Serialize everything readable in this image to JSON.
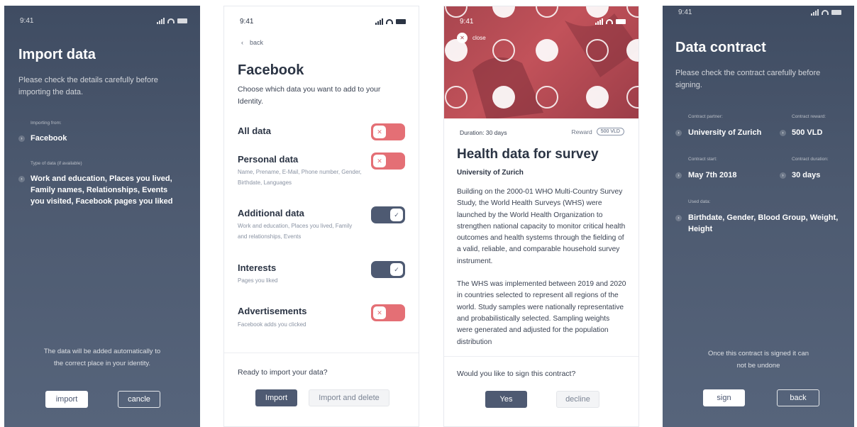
{
  "status_time": "9:41",
  "import_screen": {
    "title": "Import data",
    "subtitle": "Please check the details carefully before importing the data.",
    "from_label": "Importing from:",
    "from_value": "Facebook",
    "type_label": "Type of data (if available)",
    "type_value": "Work and education, Places you lived, Family names, Relationships, Events you visited, Facebook pages you liked",
    "footer_text": "The data will be added automatically to the correct place in your identity.",
    "import_button": "import",
    "cancel_button": "cancle"
  },
  "facebook_screen": {
    "back_label": "back",
    "title": "Facebook",
    "subtitle": "Choose which data you want to add to your Identity.",
    "items": [
      {
        "title": "All data",
        "desc": "",
        "on": false
      },
      {
        "title": "Personal data",
        "desc": "Name, Prename, E-Mail, Phone number, Gender, Birthdate, Languages",
        "on": false
      },
      {
        "title": "Additional data",
        "desc": "Work and education, Places you lived, Family and relationships, Events",
        "on": true
      },
      {
        "title": "Interests",
        "desc": "Pages you liked",
        "on": true
      },
      {
        "title": "Advertisements",
        "desc": "Facebook adds you clicked",
        "on": false
      }
    ],
    "ready_text": "Ready to import your data?",
    "import_button": "Import",
    "import_delete_button": "Import and delete"
  },
  "survey_screen": {
    "close_label": "close",
    "duration": "Duration: 30 days",
    "reward_label": "Reward",
    "reward_badge": "500 VLD",
    "title": "Health data for survey",
    "org": "University of Zurich",
    "paragraph1": "Building on the 2000-01 WHO Multi-Country Survey Study, the World Health Surveys (WHS) were launched by the World Health Organization to strengthen national capacity to monitor critical health outcomes and health systems through the fielding of a valid, reliable, and comparable household survey instrument.",
    "paragraph2": "The WHS was implemented between 2019 and 2020 in countries selected to represent all regions of the world. Study samples were nationally representative and probabilistically selected. Sampling weights were generated and adjusted for the population distribution",
    "question": "Would you like to sign this contract?",
    "yes_button": "Yes",
    "decline_button": "decline"
  },
  "contract_screen": {
    "title": "Data contract",
    "subtitle": "Please check the contract carefully before signing.",
    "partner_label": "Contract partner:",
    "partner_value": "University of Zurich",
    "reward_label": "Contract reward:",
    "reward_value": "500 VLD",
    "start_label": "Contract start:",
    "start_value": "May 7th 2018",
    "duration_label": "Contract duration:",
    "duration_value": "30 days",
    "used_label": "Used data:",
    "used_value": "Birthdate, Gender, Blood Group, Weight, Height",
    "footer_text": "Once this contract is signed it can not be undone",
    "sign_button": "sign",
    "back_button": "back"
  },
  "colors": {
    "dark_bg": "#4a566c",
    "toggle_off": "#e46f75",
    "toggle_on": "#4e5a72"
  }
}
